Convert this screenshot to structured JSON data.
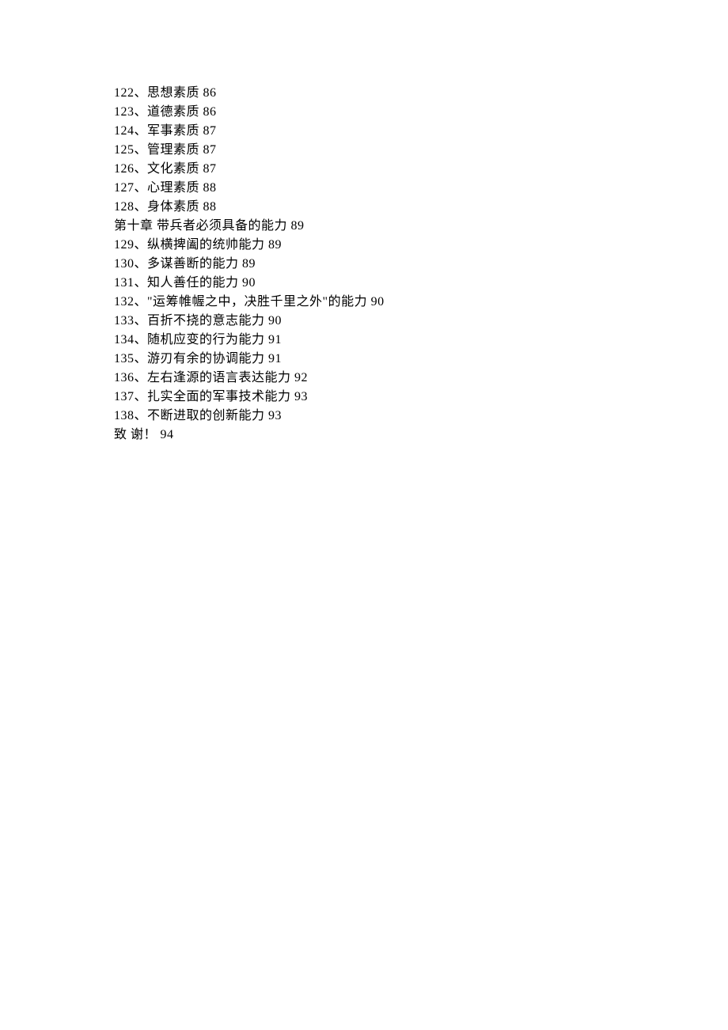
{
  "lines": [
    "122、思想素质  86",
    "123、道德素质  86",
    "124、军事素质  87",
    "125、管理素质  87",
    "126、文化素质  87",
    "127、心理素质  88",
    "128、身体素质  88",
    "第十章  带兵者必须具备的能力  89",
    "129、纵横捭阖的统帅能力  89",
    "130、多谋善断的能力  89",
    "131、知人善任的能力  90",
    "132、\"运筹帷幄之中，决胜千里之外\"的能力  90",
    "133、百折不挠的意志能力  90",
    "134、随机应变的行为能力  91",
    "135、游刃有余的协调能力  91",
    "136、左右逢源的语言表达能力  92",
    "137、扎实全面的军事技术能力  93",
    "138、不断进取的创新能力  93",
    "致 谢！   94"
  ]
}
